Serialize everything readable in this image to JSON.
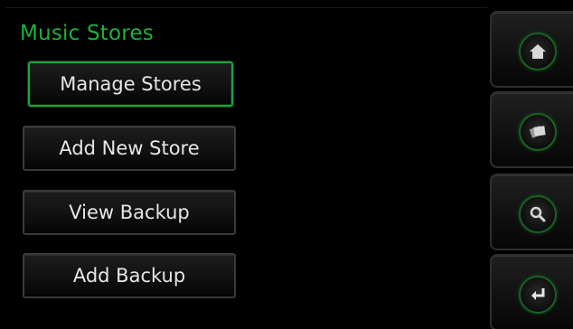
{
  "header": {
    "title": "Music Stores"
  },
  "menu": {
    "items": [
      {
        "label": "Manage Stores",
        "selected": true
      },
      {
        "label": "Add New Store",
        "selected": false
      },
      {
        "label": "View Backup",
        "selected": false
      },
      {
        "label": "Add Backup",
        "selected": false
      }
    ]
  },
  "sidebar": {
    "buttons": [
      {
        "icon": "home-icon"
      },
      {
        "icon": "cards-icon"
      },
      {
        "icon": "search-icon"
      },
      {
        "icon": "back-icon"
      }
    ]
  },
  "colors": {
    "accent": "#1fb03b",
    "background": "#000000",
    "text": "#e6e6e6"
  }
}
